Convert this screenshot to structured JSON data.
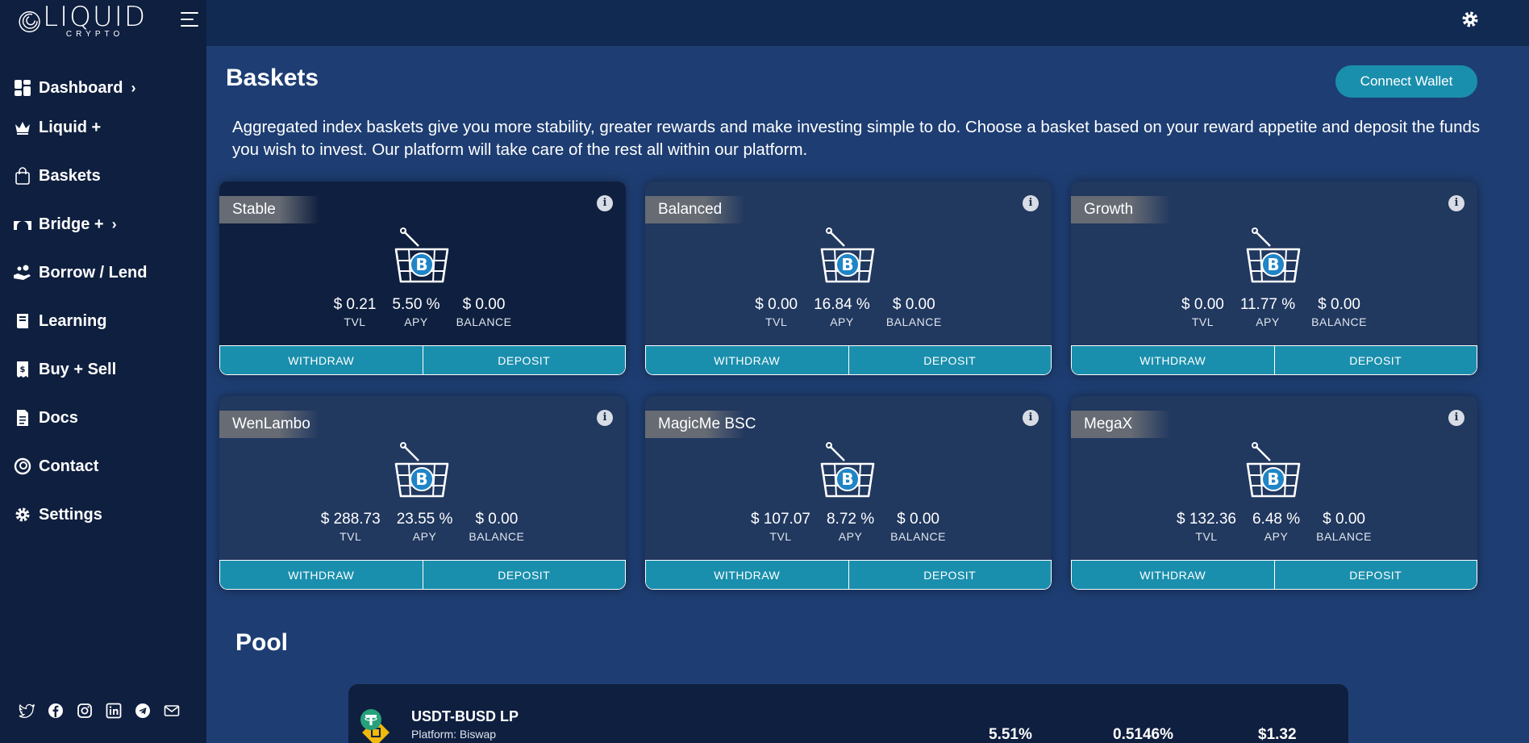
{
  "brand": {
    "logo_main": "LIQUID",
    "logo_sub": "CRYPTO"
  },
  "sidebar": {
    "items": [
      {
        "label": "Dashboard",
        "icon": "dashboard-icon",
        "chevron": true
      },
      {
        "label": "Liquid +",
        "icon": "crown-icon",
        "chevron": false
      },
      {
        "label": "Baskets",
        "icon": "shopping-bag-icon",
        "chevron": false
      },
      {
        "label": "Bridge +",
        "icon": "bridge-icon",
        "chevron": true
      },
      {
        "label": "Borrow / Lend",
        "icon": "hand-coins-icon",
        "chevron": false
      },
      {
        "label": "Learning",
        "icon": "book-icon",
        "chevron": false
      },
      {
        "label": "Buy + Sell",
        "icon": "receipt-icon",
        "chevron": false
      },
      {
        "label": "Docs",
        "icon": "document-icon",
        "chevron": false
      },
      {
        "label": "Contact",
        "icon": "contact-icon",
        "chevron": false
      },
      {
        "label": "Settings",
        "icon": "gear-icon",
        "chevron": false
      }
    ],
    "social": [
      "twitter-icon",
      "facebook-icon",
      "instagram-icon",
      "linkedin-icon",
      "telegram-icon",
      "mail-icon"
    ]
  },
  "header": {
    "title": "Baskets",
    "connect_label": "Connect Wallet"
  },
  "intro": "Aggregated index baskets give you more stability, greater rewards and make investing simple to do. Choose a basket based on your reward appetite and deposit the funds you wish to invest. Our platform will take care of the rest all within our platform.",
  "stat_labels": {
    "tvl": "TVL",
    "apy": "APY",
    "balance": "BALANCE"
  },
  "buttons": {
    "withdraw": "WITHDRAW",
    "deposit": "DEPOSIT"
  },
  "baskets": [
    {
      "name": "Stable",
      "tvl": "$ 0.21",
      "apy": "5.50 %",
      "balance": "$ 0.00"
    },
    {
      "name": "Balanced",
      "tvl": "$ 0.00",
      "apy": "16.84 %",
      "balance": "$ 0.00"
    },
    {
      "name": "Growth",
      "tvl": "$ 0.00",
      "apy": "11.77 %",
      "balance": "$ 0.00"
    },
    {
      "name": "WenLambo",
      "tvl": "$ 288.73",
      "apy": "23.55 %",
      "balance": "$ 0.00"
    },
    {
      "name": "MagicMe BSC",
      "tvl": "$ 107.07",
      "apy": "8.72 %",
      "balance": "$ 0.00"
    },
    {
      "name": "MegaX",
      "tvl": "$ 132.36",
      "apy": "6.48 %",
      "balance": "$ 0.00"
    }
  ],
  "pool": {
    "title": "Pool",
    "rows": [
      {
        "name": "USDT-BUSD LP",
        "platform": "Platform: Biswap",
        "apr": "5.51%",
        "daily": "0.5146%",
        "value": "$1.32"
      }
    ]
  },
  "colors": {
    "sidebar_bg": "#0f1f3f",
    "main_bg": "#1e3e73",
    "accent": "#1a8fad",
    "card_bg": "#21385f"
  }
}
